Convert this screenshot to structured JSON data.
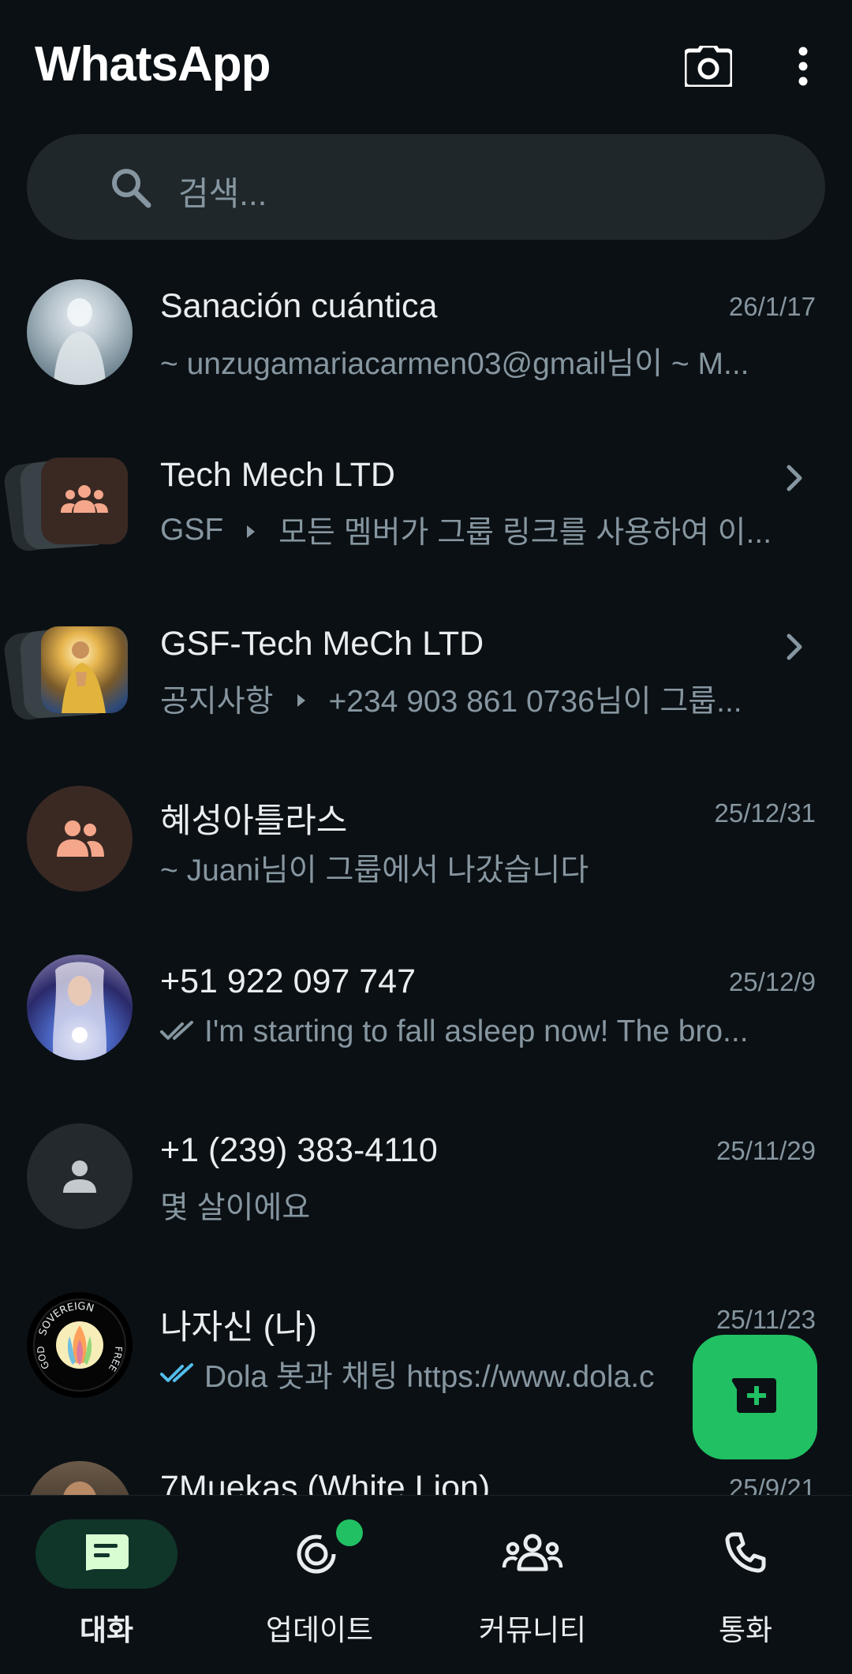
{
  "app": {
    "title": "WhatsApp"
  },
  "search": {
    "placeholder": "검색..."
  },
  "chats": [
    {
      "name": "Sanación cuántica",
      "time": "26/1/17",
      "preview": "~ unzugamariacarmen03@gmail님이 ~ M..."
    },
    {
      "name": "Tech Mech LTD",
      "time": "",
      "preview_group": "GSF",
      "preview": "모든 멤버가 그룹 링크를 사용하여 이..."
    },
    {
      "name": "GSF-Tech MeCh LTD",
      "time": "",
      "preview_group": "공지사항",
      "preview": "+234 903 861 0736님이 그룹..."
    },
    {
      "name": "혜성아틀라스",
      "time": "25/12/31",
      "preview": "~ Juani님이 그룹에서 나갔습니다"
    },
    {
      "name": "+51 922 097 747",
      "time": "25/12/9",
      "preview": "I'm starting to fall asleep now! The bro..."
    },
    {
      "name": "+1 (239) 383-4110",
      "time": "25/11/29",
      "preview": "몇 살이에요"
    },
    {
      "name": "나자신 (나)",
      "time": "25/11/23",
      "preview": "Dola 봇과 채팅 https://www.dola.c"
    },
    {
      "name": "7Muekas (White Lion)",
      "time": "25/9/21",
      "preview": ""
    }
  ],
  "avatar_text": {
    "sovereign": "SOVEREIGN",
    "free": "FREE",
    "god": "GOD"
  },
  "nav": [
    {
      "label": "대화",
      "active": true
    },
    {
      "label": "업데이트",
      "active": false
    },
    {
      "label": "커뮤니티",
      "active": false
    },
    {
      "label": "통화",
      "active": false
    }
  ],
  "colors": {
    "accent": "#21c063",
    "background": "#0b1014",
    "read_tick": "#53bdeb",
    "muted": "#8696a0"
  }
}
